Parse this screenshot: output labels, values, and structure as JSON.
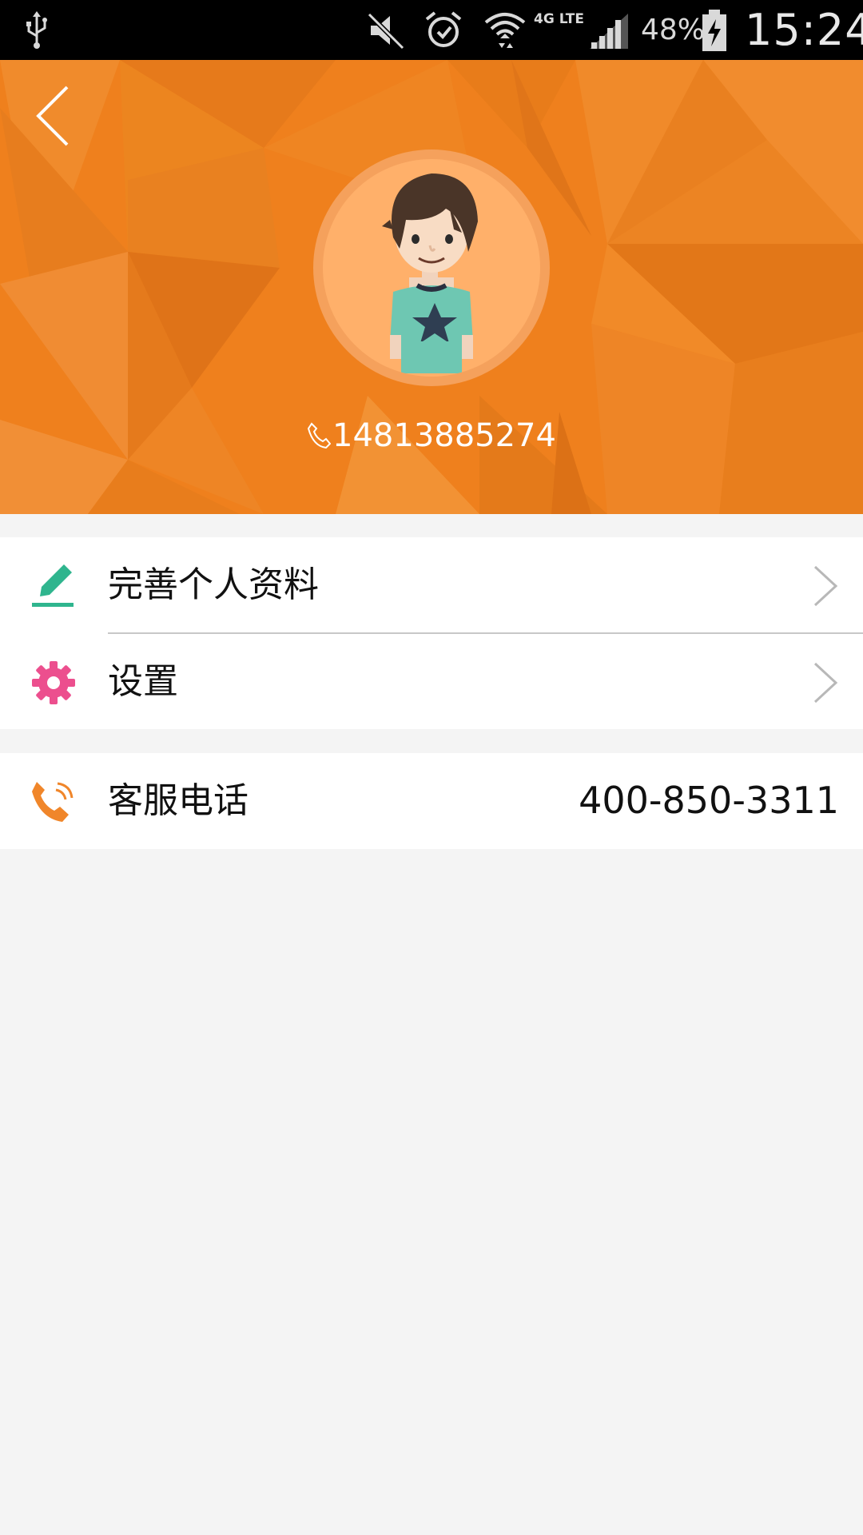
{
  "status_bar": {
    "battery_percent": "48%",
    "time": "15:24",
    "network": "4G LTE",
    "icons": [
      "usb-icon",
      "mute-icon",
      "alarm-icon",
      "wifi-icon",
      "signal-icon",
      "battery-icon"
    ]
  },
  "header": {
    "background_color": "#ef801d",
    "back_icon": "chevron-left-icon",
    "avatar": "boy-avatar",
    "phone_icon": "phone-outline-icon",
    "phone": "14813885274"
  },
  "menu": {
    "items": [
      {
        "icon": "pencil-icon",
        "icon_color": "#2fb58e",
        "label": "完善个人资料"
      },
      {
        "icon": "gear-icon",
        "icon_color": "#ec4f8e",
        "label": "设置"
      }
    ]
  },
  "service": {
    "icon": "phone-ring-icon",
    "icon_color": "#f0862a",
    "label": "客服电话",
    "value": "400-850-3311"
  }
}
